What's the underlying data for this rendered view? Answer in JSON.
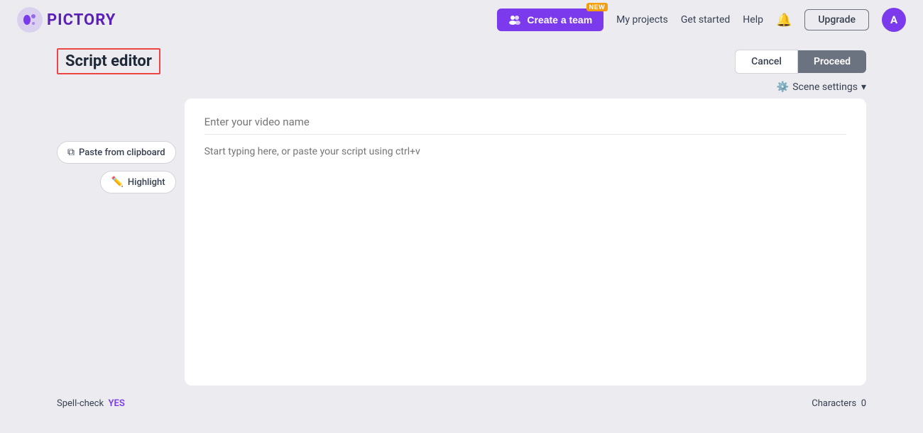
{
  "header": {
    "logo_text": "PICTORY",
    "create_team_label": "Create a team",
    "new_badge": "NEW",
    "my_projects_label": "My projects",
    "get_started_label": "Get started",
    "help_label": "Help",
    "upgrade_label": "Upgrade",
    "avatar_letter": "A"
  },
  "page": {
    "title": "Script editor",
    "cancel_label": "Cancel",
    "proceed_label": "Proceed",
    "scene_settings_label": "Scene settings"
  },
  "sidebar": {
    "paste_label": "Paste from clipboard",
    "highlight_label": "Highlight"
  },
  "editor": {
    "video_name_placeholder": "Enter your video name",
    "script_placeholder": "Start typing here, or paste your script using ctrl+v"
  },
  "footer": {
    "spell_check_label": "Spell-check",
    "spell_check_value": "YES",
    "characters_label": "Characters",
    "characters_value": "0"
  }
}
